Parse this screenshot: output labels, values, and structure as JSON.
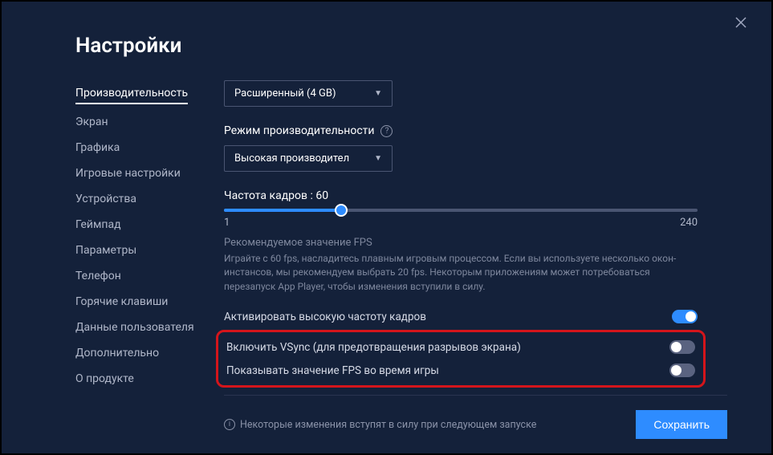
{
  "title": "Настройки",
  "sidebar": {
    "items": [
      {
        "label": "Производительность",
        "active": true
      },
      {
        "label": "Экран"
      },
      {
        "label": "Графика"
      },
      {
        "label": "Игровые настройки"
      },
      {
        "label": "Устройства"
      },
      {
        "label": "Геймпад"
      },
      {
        "label": "Параметры"
      },
      {
        "label": "Телефон"
      },
      {
        "label": "Горячие клавиши"
      },
      {
        "label": "Данные пользователя"
      },
      {
        "label": "Дополнительно"
      },
      {
        "label": "О продукте"
      }
    ]
  },
  "memory_dropdown": {
    "value": "Расширенный (4 GB)"
  },
  "perf_mode": {
    "label": "Режим производительности",
    "value": "Высокая производител"
  },
  "fps_slider": {
    "label_prefix": "Частота кадров : ",
    "value": "60",
    "min": "1",
    "max": "240"
  },
  "hint": {
    "title": "Рекомендуемое значение FPS",
    "body": "Играйте с 60 fps, насладитесь плавным игровым процессом. Если вы используете несколько окон-инстансов, мы рекомендуем выбрать 20 fps. Некоторым приложениям может потребоваться перезапуск App Player, чтобы изменения вступили в силу."
  },
  "toggles": {
    "high_fps": "Активировать высокую частоту кадров",
    "vsync": "Включить VSync (для предотвращения разрывов экрана)",
    "show_fps": "Показывать значение FPS во время игры"
  },
  "footer": {
    "note": "Некоторые изменения вступят в силу при следующем запуске",
    "save": "Сохранить"
  }
}
